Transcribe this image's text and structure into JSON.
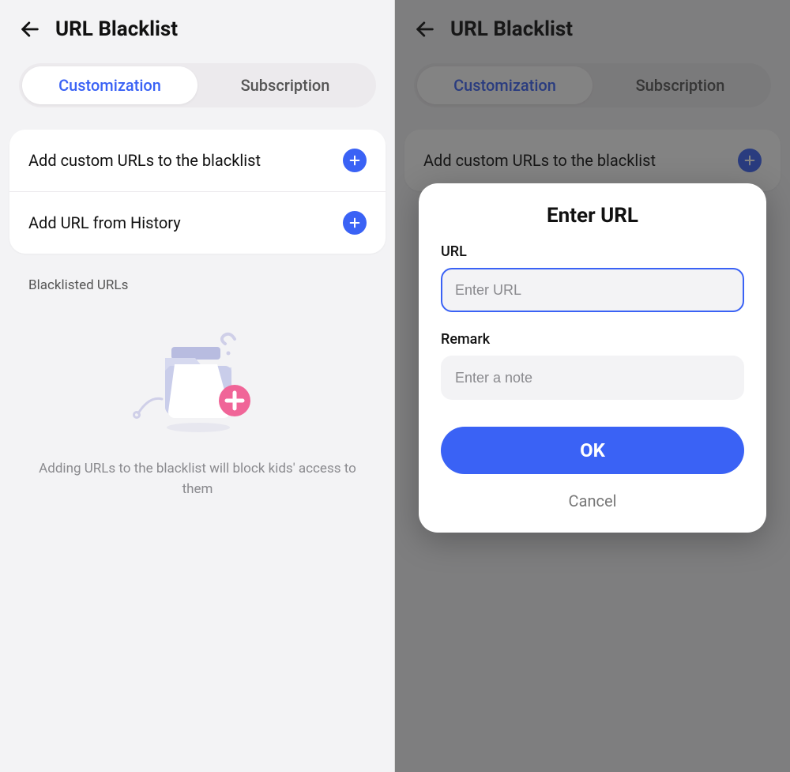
{
  "header": {
    "title": "URL Blacklist"
  },
  "tabs": {
    "customization": "Customization",
    "subscription": "Subscription"
  },
  "actions": {
    "addCustom": "Add custom URLs to the blacklist",
    "addHistory": "Add URL from History"
  },
  "section": {
    "blacklisted": "Blacklisted URLs"
  },
  "empty": {
    "hint": "Adding URLs to the blacklist will block kids' access to them"
  },
  "dialog": {
    "title": "Enter URL",
    "urlLabel": "URL",
    "urlPlaceholder": "Enter URL",
    "remarkLabel": "Remark",
    "remarkPlaceholder": "Enter a note",
    "ok": "OK",
    "cancel": "Cancel"
  }
}
